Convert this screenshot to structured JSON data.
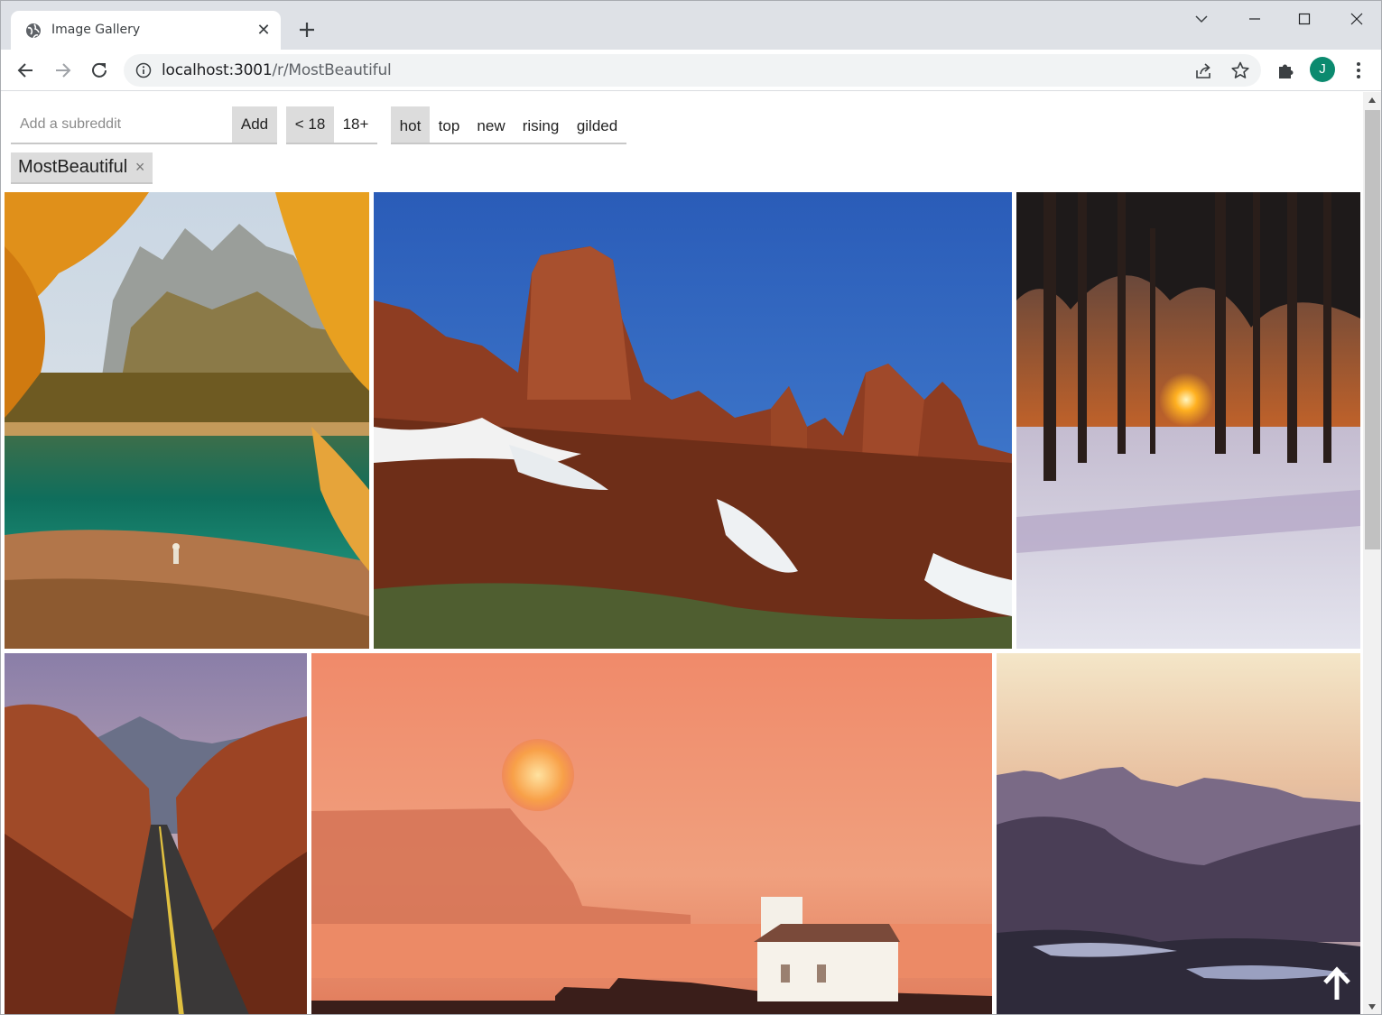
{
  "browser": {
    "tab_title": "Image Gallery",
    "url_host": "localhost:3001",
    "url_path": "/r/MostBeautiful",
    "avatar_initial": "J",
    "icons": [
      "globe-icon",
      "close-icon",
      "plus-icon",
      "chevron-down-icon",
      "minimize-icon",
      "maximize-icon",
      "window-close-icon",
      "back-arrow-icon",
      "forward-arrow-icon",
      "reload-icon",
      "info-icon",
      "share-icon",
      "star-icon",
      "puzzle-icon",
      "menu-dots-icon"
    ]
  },
  "controls": {
    "subreddit_placeholder": "Add a subreddit",
    "add_label": "Add",
    "age_filters": [
      "< 18",
      "18+"
    ],
    "age_selected": "< 18",
    "sort_options": [
      "hot",
      "top",
      "new",
      "rising",
      "gilded"
    ],
    "sort_selected": "hot"
  },
  "subreddits": [
    {
      "name": "MostBeautiful",
      "remove_glyph": "×"
    }
  ],
  "gallery": {
    "photos": [
      {
        "subject": "autumn lake with mountain peaks and hiker"
      },
      {
        "subject": "red rock spires with snow under blue sky"
      },
      {
        "subject": "sunset through pine trees over snowy field"
      },
      {
        "subject": "desert road through red rock canyon"
      },
      {
        "subject": "orange sunset over cliffs and white church"
      },
      {
        "subject": "dusk over mesas and lake"
      }
    ],
    "scroll_to_top_icon": "arrow-up-icon"
  },
  "colors": {
    "tabstrip": "#dee1e6",
    "button_bg": "#dcdcdc",
    "avatar": "#0b8a6f"
  }
}
